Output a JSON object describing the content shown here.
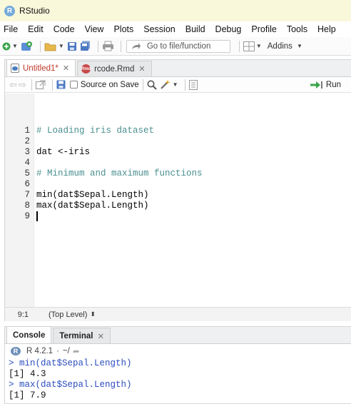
{
  "window": {
    "title": "RStudio",
    "logo_letter": "R"
  },
  "menu": [
    "File",
    "Edit",
    "Code",
    "View",
    "Plots",
    "Session",
    "Build",
    "Debug",
    "Profile",
    "Tools",
    "Help"
  ],
  "toolbar": {
    "goto_placeholder": "Go to file/function",
    "addins_label": "Addins"
  },
  "editor": {
    "tabs": [
      {
        "label": "Untitled1*",
        "active": true,
        "icon": "r-script-icon"
      },
      {
        "label": "rcode.Rmd",
        "active": false,
        "icon": "rmarkdown-icon"
      }
    ],
    "rmd_badge": "Rmd",
    "source_on_save_label": "Source on Save",
    "run_label": "Run",
    "line_numbers": [
      "1",
      "2",
      "3",
      "4",
      "5",
      "6",
      "7",
      "8",
      "9"
    ],
    "lines": [
      "# Loading iris dataset",
      "",
      "dat <-iris",
      "",
      "# Minimum and maximum functions",
      "",
      "min(dat$Sepal.Length)",
      "max(dat$Sepal.Length)",
      ""
    ],
    "cursor_position": "9:1",
    "scope": "(Top Level)"
  },
  "console": {
    "tabs": [
      {
        "label": "Console",
        "active": true
      },
      {
        "label": "Terminal",
        "active": false
      }
    ],
    "r_version": "R 4.2.1",
    "working_dir": "~/",
    "output": [
      {
        "kind": "cmd",
        "text": "> min(dat$Sepal.Length)"
      },
      {
        "kind": "res",
        "text": "[1] 4.3"
      },
      {
        "kind": "cmd",
        "text": "> max(dat$Sepal.Length)"
      },
      {
        "kind": "res",
        "text": "[1] 7.9"
      }
    ]
  },
  "colors": {
    "titlebar_bg": "#faf8db",
    "comment": "#4a8f8f",
    "console_cmd": "#2c4dbf",
    "dirty_tab": "#c0392b"
  }
}
